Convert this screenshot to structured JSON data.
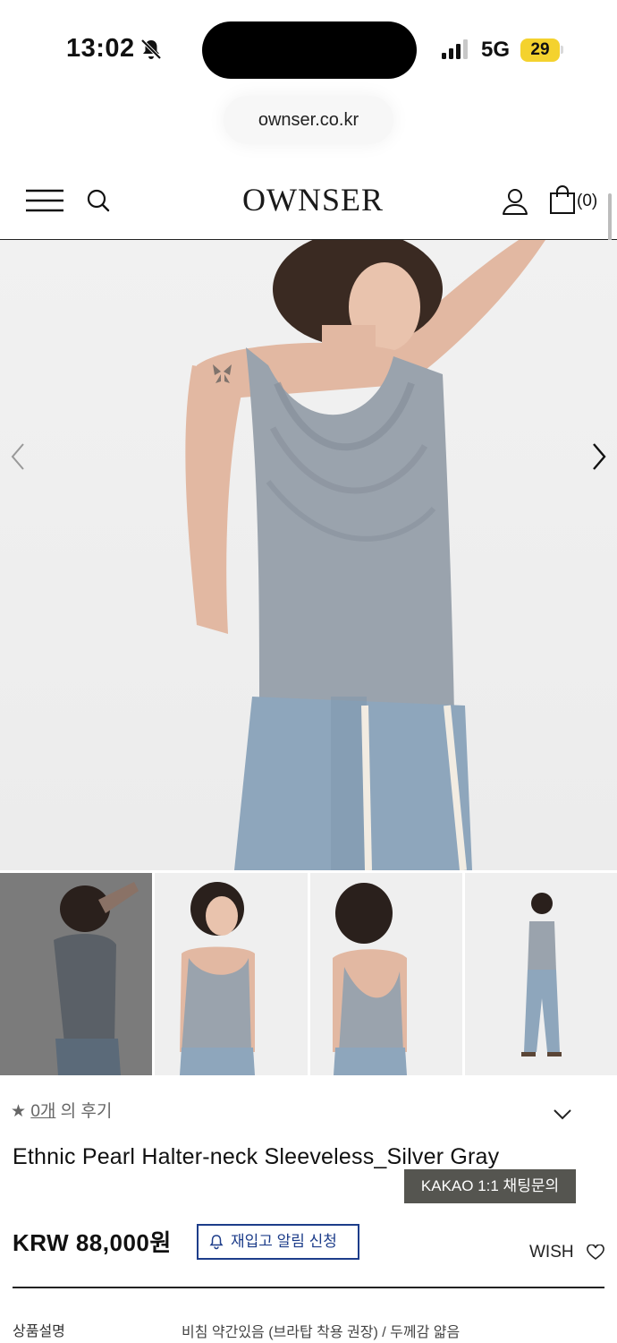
{
  "status_bar": {
    "time": "13:02",
    "network": "5G",
    "battery": "29"
  },
  "browser": {
    "url": "ownser.co.kr"
  },
  "header": {
    "logo": "OWNSER",
    "cart_count": "(0)"
  },
  "gallery": {
    "image_count": 4,
    "active_index": 0
  },
  "product": {
    "review_prefix": "★ ",
    "review_count": "0개",
    "review_suffix": " 의 후기",
    "name": "Ethnic Pearl Halter-neck Sleeveless_Silver Gray",
    "kakao_label": "KAKAO 1:1 채팅문의",
    "price": "KRW 88,000원",
    "restock_label": "재입고 알림 신청",
    "wish_label": "WISH",
    "description_label": "상품설명",
    "description_value": "비침 약간있음 (브라탑 착용 권장) / 두께감 얇음"
  },
  "colors": {
    "accent_blue": "#1d3d8a",
    "kakao_bg": "#555550",
    "battery": "#f4d22e",
    "garment": "#9aa3ad",
    "denim": "#8ea6bc"
  }
}
